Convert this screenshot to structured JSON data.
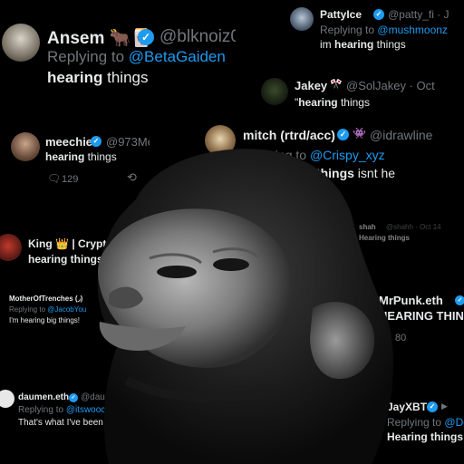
{
  "tweets": [
    {
      "name": "Ansem",
      "emoji": "🐂🀄",
      "handle": "@blknoiz0(",
      "reply_prefix": "Replying to",
      "reply_to": "@BetaGaiden",
      "pre": "",
      "bold": "hearing",
      "post": " things"
    },
    {
      "name": "PattyIce",
      "emoji": "🌵",
      "handle": "@patty_fi · J",
      "reply_prefix": "Replying to",
      "reply_to": "@mushmoonz",
      "pre": "im ",
      "bold": "hearing",
      "post": " things"
    },
    {
      "name": "Jakey",
      "emoji": "🎌",
      "handle": "@SolJakey · Oct",
      "reply_prefix": "",
      "reply_to": "",
      "pre": "\"",
      "bold": "hearing",
      "post": " things"
    },
    {
      "name": "meechie",
      "emoji": "",
      "handle": "@973Me",
      "reply_prefix": "",
      "reply_to": "",
      "pre": "",
      "bold": "hearing",
      "post": " things",
      "stat1": "129"
    },
    {
      "name": "mitch (rtrd/acc)",
      "emoji": "👾",
      "handle": "@idrawline",
      "reply_prefix": "Replying to",
      "reply_to": "@Crispy_xyz",
      "pre": "hes ",
      "bold": "hearing things",
      "post": " isnt he"
    },
    {
      "name": "shah",
      "emoji": "🔵",
      "handle": "@shahh · Oct 14",
      "reply_prefix": "",
      "reply_to": "",
      "pre": "",
      "bold": "Hearing things",
      "post": ""
    },
    {
      "name": "King",
      "emoji": "👑",
      "handle": "| Crypt",
      "reply_prefix": "",
      "reply_to": "",
      "pre": "",
      "bold": "hearing things",
      "post": ""
    },
    {
      "name": "MotherOfTrenches",
      "emoji": "(◞)",
      "handle": "",
      "reply_prefix": "Replying to",
      "reply_to": "@JacobYou",
      "pre": "I'm hearing big things!",
      "bold": "",
      "post": ""
    },
    {
      "name": "MrPunk.eth",
      "emoji": "",
      "handle": "",
      "reply_prefix": "",
      "reply_to": "",
      "pre": "",
      "bold": "HEARING THING",
      "post": "",
      "stat1": "80"
    },
    {
      "name": "daumen.eth",
      "emoji": "",
      "handle": "@daumen",
      "reply_prefix": "Replying to",
      "reply_to": "@itswooch @TeThe",
      "pre": "That's what I've been ",
      "bold": "hearing",
      "post": ""
    },
    {
      "name": "JayXBT",
      "emoji": "▶",
      "handle": "",
      "reply_prefix": "Replying to",
      "reply_to": "@De",
      "pre": "",
      "bold": "Hearing things",
      "post": ""
    }
  ],
  "colors": {
    "accent": "#1d9bf0",
    "muted": "#71767b",
    "text": "#e7e9ea",
    "background": "#000000"
  }
}
